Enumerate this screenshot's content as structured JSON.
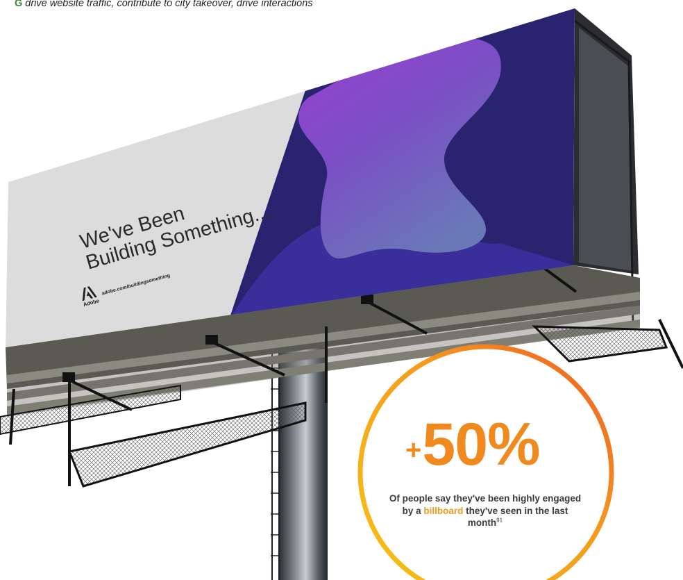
{
  "caption": {
    "prefix": "G",
    "text": "drive website traffic, contribute to city takeover, drive interactions"
  },
  "billboard": {
    "headline_line1": "We've Been",
    "headline_line2": "Building Something...",
    "brand": "Adobe",
    "url": "adobe.com/buildingsomething"
  },
  "stat": {
    "plus": "+",
    "value": "50%",
    "text_before": "Of people say they've been highly engaged by a ",
    "highlight": "billboard",
    "text_after": " they've seen in the last month",
    "footnote": "91"
  },
  "colors": {
    "accent_orange": "#f08a1e",
    "accent_yellow": "#f5c518",
    "billboard_purple": "#8a3fd0",
    "billboard_navy": "#2a2470"
  }
}
